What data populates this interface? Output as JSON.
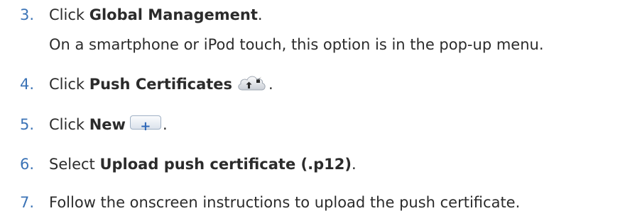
{
  "steps": [
    {
      "number": "3.",
      "lead": "Click ",
      "bold": "Global Management",
      "trail": ".",
      "detail": "On a smartphone or iPod touch, this option is in the pop-up menu."
    },
    {
      "number": "4.",
      "lead": "Click ",
      "bold": "Push Certificates",
      "icon": "cloud-push-icon",
      "trail": "."
    },
    {
      "number": "5.",
      "lead": "Click ",
      "bold": "New",
      "icon": "plus-button-icon",
      "icon_glyph": "+",
      "trail": "."
    },
    {
      "number": "6.",
      "lead": "Select ",
      "bold": "Upload push certificate (.p12)",
      "trail": "."
    },
    {
      "number": "7.",
      "lead": "Follow the onscreen instructions to upload the push certificate.",
      "bold": "",
      "trail": ""
    }
  ],
  "colors": {
    "number": "#3b73b6",
    "text": "#2b2b2b",
    "plus_glyph": "#2f68b8"
  }
}
